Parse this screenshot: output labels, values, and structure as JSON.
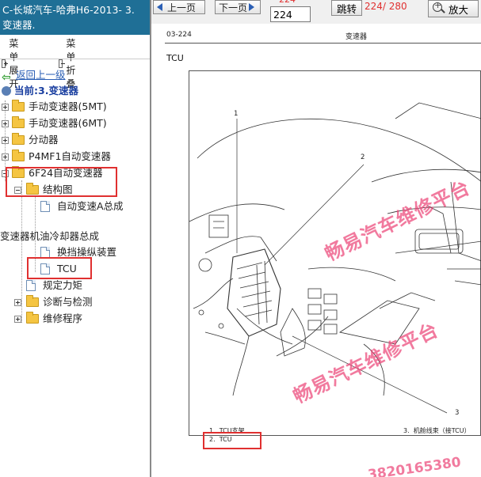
{
  "left_panel": {
    "title": "C-长城汽车-哈弗H6-2013- 3.变速器.",
    "title_line1": "C-长城汽车-哈弗H6-2013- 3.",
    "title_line2": "变速器.",
    "expand_label": "菜单展开",
    "collapse_label": "菜单折叠",
    "back_label": "返回上一级",
    "current_label": "当前:3.变速器",
    "tree": [
      {
        "label": "手动变速器(5MT)",
        "type": "folder",
        "expanded": false
      },
      {
        "label": "手动变速器(6MT)",
        "type": "folder",
        "expanded": false
      },
      {
        "label": "分动器",
        "type": "folder",
        "expanded": false
      },
      {
        "label": "P4MF1自动变速器",
        "type": "folder",
        "expanded": false
      },
      {
        "label": "6F24自动变速器",
        "type": "folder",
        "expanded": true
      },
      {
        "label": "结构图",
        "type": "folder",
        "expanded": true
      },
      {
        "label": "自动变速A总成",
        "type": "doc"
      },
      {
        "label": "变速器机油冷却器总成",
        "type": "doc"
      },
      {
        "label": "换挡操纵装置",
        "type": "doc"
      },
      {
        "label": "TCU",
        "type": "doc",
        "selected": true
      },
      {
        "label": "规定力矩",
        "type": "doc"
      },
      {
        "label": "诊断与检测",
        "type": "folder",
        "expanded": false
      },
      {
        "label": "维修程序",
        "type": "folder",
        "expanded": false
      }
    ]
  },
  "toolbar": {
    "prev_label": "上一页",
    "next_label": "下一页",
    "current_page_value": "224",
    "current_page_partial": "224",
    "jump_label": "跳转",
    "page_count": "224/ 280",
    "zoom_label": "放大"
  },
  "document": {
    "page_code": "03-224",
    "header": "变速器",
    "section_title": "TCU",
    "callouts": [
      "1",
      "2",
      "3"
    ],
    "legend": [
      {
        "num": "1.",
        "text": "TCU支架"
      },
      {
        "num": "2.",
        "text": "TCU"
      },
      {
        "num": "3.",
        "text": "机舱线束（接TCU）"
      }
    ],
    "watermark": "畅易汽车维修平台",
    "phone_watermark": "3820165380"
  },
  "colors": {
    "title_bar": "#1f6f96",
    "highlight": "#e03030",
    "watermark": "#eb4678",
    "page_count": "#e03030"
  }
}
